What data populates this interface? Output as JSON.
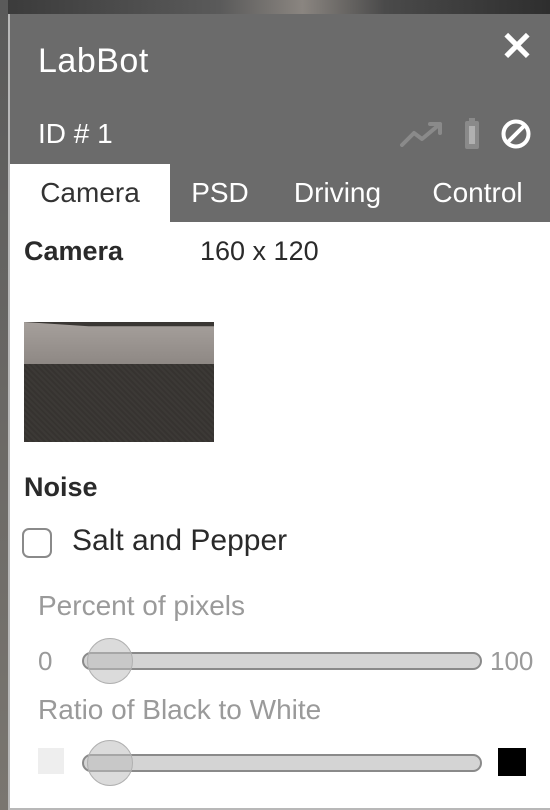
{
  "window": {
    "title": "LabBot",
    "robot_id": "ID # 1",
    "close_glyph": "✕"
  },
  "header_icons": [
    "chart-trend-icon",
    "battery-icon",
    "prohibited-icon"
  ],
  "tabs": [
    {
      "label": "Camera",
      "active": true
    },
    {
      "label": "PSD",
      "active": false
    },
    {
      "label": "Driving",
      "active": false
    },
    {
      "label": "Control",
      "active": false
    }
  ],
  "camera": {
    "label": "Camera",
    "resolution": "160 x 120"
  },
  "noise": {
    "label": "Noise",
    "salt_pepper": {
      "label": "Salt and Pepper",
      "checked": false
    },
    "percent_slider": {
      "label": "Percent of pixels",
      "min_label": "0",
      "max_label": "100",
      "value_fraction": 0.05
    },
    "ratio_slider": {
      "label": "Ratio of Black to White",
      "value_fraction": 0.05
    }
  },
  "colors": {
    "header_bg": "#6b6b6b",
    "disabled_text": "#9a9a9a",
    "icon_dim": "#8a8a8a"
  }
}
